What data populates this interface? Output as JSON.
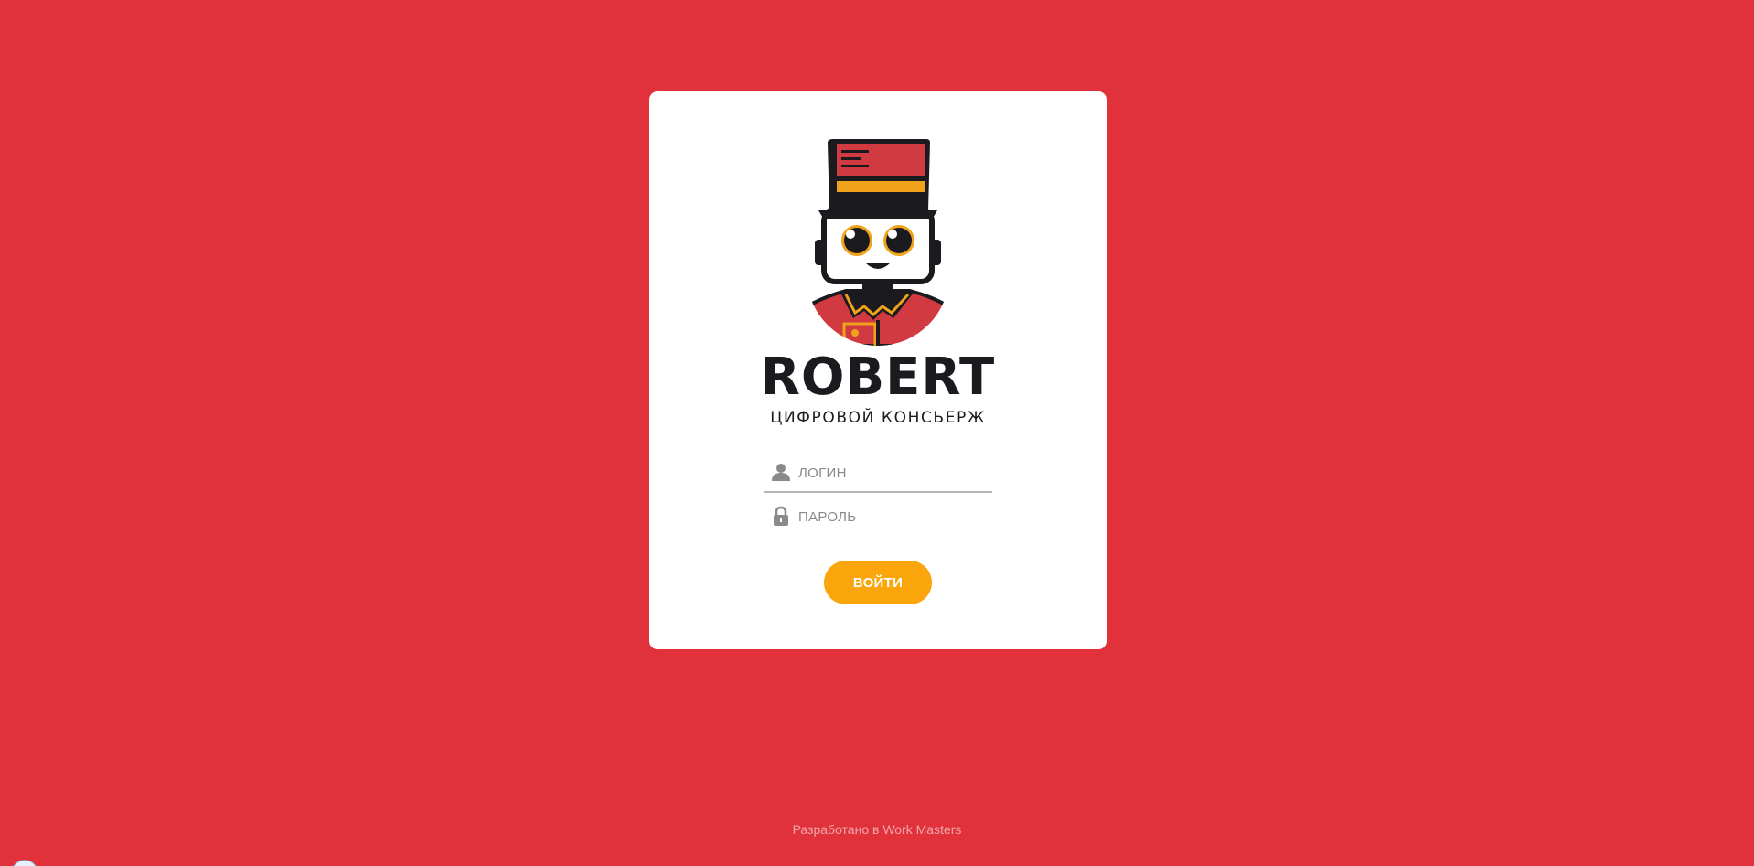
{
  "brand": {
    "name": "ROBERT",
    "tagline": "ЦИФРОВОЙ КОНСЬЕРЖ",
    "logo_icon": "robot-concierge-mascot"
  },
  "form": {
    "login": {
      "placeholder": "ЛОГИН",
      "value": "",
      "icon": "user-icon"
    },
    "password": {
      "placeholder": "ПАРОЛЬ",
      "value": "",
      "icon": "lock-icon"
    },
    "submit_label": "ВОЙТИ"
  },
  "footer": {
    "text": "Разработано в Work Masters"
  },
  "colors": {
    "background": "#e1313b",
    "card": "#ffffff",
    "accent": "#f9a50b",
    "text_dark": "#1b1b1f",
    "input_underline": "#b5b5b5"
  }
}
